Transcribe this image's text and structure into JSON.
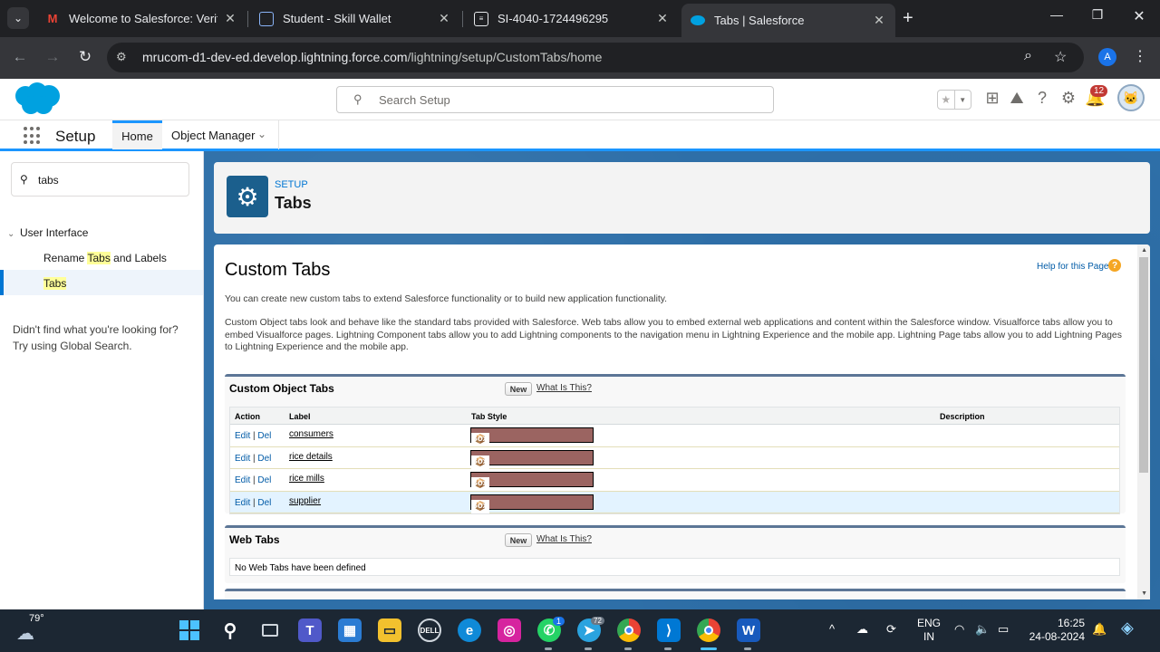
{
  "browser": {
    "tabs": [
      {
        "title": "Welcome to Salesforce: Verify y",
        "favicon": "gmail-icon"
      },
      {
        "title": "Student - Skill Wallet",
        "favicon": "skillwallet-icon"
      },
      {
        "title": "SI-4040-1724496295",
        "favicon": "document-icon"
      },
      {
        "title": "Tabs | Salesforce",
        "favicon": "salesforce-cloud-icon"
      }
    ],
    "url_host": "mrucom-d1-dev-ed.develop.lightning.force.com",
    "url_path": "/lightning/setup/CustomTabs/home",
    "profile_initial": "A"
  },
  "sf": {
    "search_placeholder": "Search Setup",
    "notification_count": "12",
    "app_title": "Setup",
    "nav_home": "Home",
    "nav_object_manager": "Object Manager"
  },
  "sidebar": {
    "quickfind_value": "tabs",
    "tree_parent": "User Interface",
    "item1_pre": "Rename ",
    "item1_hl": "Tabs",
    "item1_post": " and Labels",
    "item2": "Tabs",
    "footer_line1": "Didn't find what you're looking for?",
    "footer_line2": "Try using Global Search."
  },
  "page_header": {
    "eyebrow": "SETUP",
    "title": "Tabs"
  },
  "panel": {
    "title": "Custom Tabs",
    "help_link": "Help for this Page",
    "intro": "You can create new custom tabs to extend Salesforce functionality or to build new application functionality.",
    "description": "Custom Object tabs look and behave like the standard tabs provided with Salesforce. Web tabs allow you to embed external web applications and content within the Salesforce window. Visualforce tabs allow you to embed Visualforce pages. Lightning Component tabs allow you to add Lightning components to the navigation menu in Lightning Experience and the mobile app. Lightning Page tabs allow you to add Lightning Pages to Lightning Experience and the mobile app."
  },
  "custom_object_tabs": {
    "title": "Custom Object Tabs",
    "new_label": "New",
    "what_is_this": "What Is This?",
    "columns": {
      "action": "Action",
      "label": "Label",
      "tab_style": "Tab Style",
      "description": "Description"
    },
    "edit": "Edit",
    "sep": " | ",
    "del": "Del",
    "rows": [
      {
        "label": "consumers",
        "style": "Box",
        "description": ""
      },
      {
        "label": "rice details",
        "style": "Box",
        "description": ""
      },
      {
        "label": "rice mills",
        "style": "Box",
        "description": ""
      },
      {
        "label": "supplier",
        "style": "Box",
        "description": ""
      }
    ]
  },
  "web_tabs": {
    "title": "Web Tabs",
    "new_label": "New",
    "what_is_this": "What Is This?",
    "empty": "No Web Tabs have been defined"
  },
  "taskbar": {
    "temperature": "79°",
    "lang1": "ENG",
    "lang2": "IN",
    "time": "16:25",
    "date": "24-08-2024",
    "whatsapp_badge": "1",
    "telegram_badge": "72"
  },
  "colors": {
    "sf_blue": "#0176d3",
    "tab_style_box": "#9b6461",
    "content_bg": "#2e6fa8"
  }
}
